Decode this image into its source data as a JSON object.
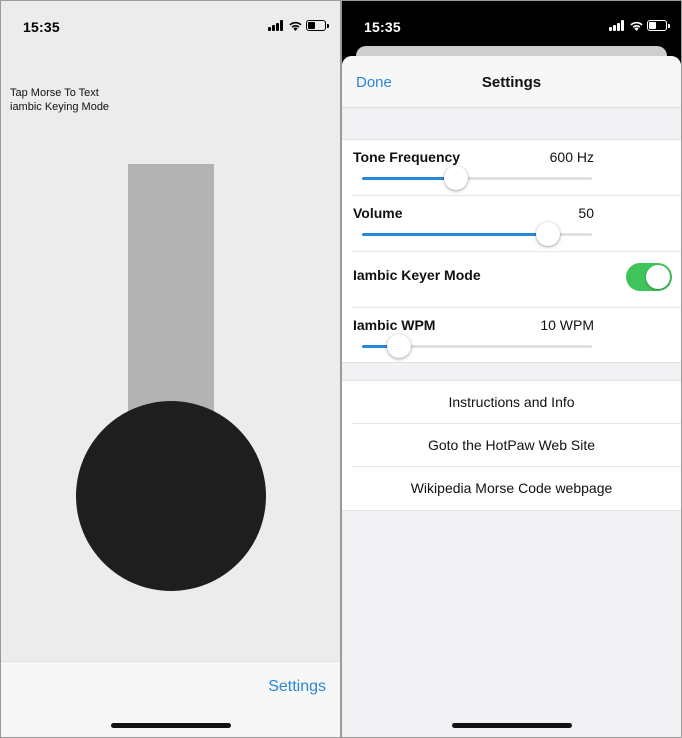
{
  "left_screen": {
    "status_time": "15:35",
    "mode_line1": "Tap Morse To Text",
    "mode_line2": "iambic Keying Mode",
    "settings_label": "Settings"
  },
  "right_screen": {
    "status_time": "15:35",
    "navbar": {
      "done_label": "Done",
      "title": "Settings"
    },
    "tone_frequency": {
      "label": "Tone Frequency",
      "value": "600 Hz",
      "slider_fraction": 0.41
    },
    "volume": {
      "label": "Volume",
      "value": "50",
      "slider_fraction": 0.81
    },
    "iambic_keyer_mode": {
      "label": "Iambic Keyer Mode",
      "enabled": true
    },
    "iambic_wpm": {
      "label": "Iambic WPM",
      "value": "10 WPM",
      "slider_fraction": 0.16
    },
    "links": [
      {
        "label": "Instructions and Info"
      },
      {
        "label": "Goto the HotPaw Web Site"
      },
      {
        "label": "Wikipedia Morse Code webpage"
      }
    ]
  },
  "colors": {
    "accent": "#2a86d6",
    "toggle_on": "#3fc35b",
    "key_dark": "#1e1e1e",
    "key_stem": "#b3b3b3"
  },
  "icons": [
    "cellular-signal-icon",
    "wifi-icon",
    "battery-icon"
  ]
}
